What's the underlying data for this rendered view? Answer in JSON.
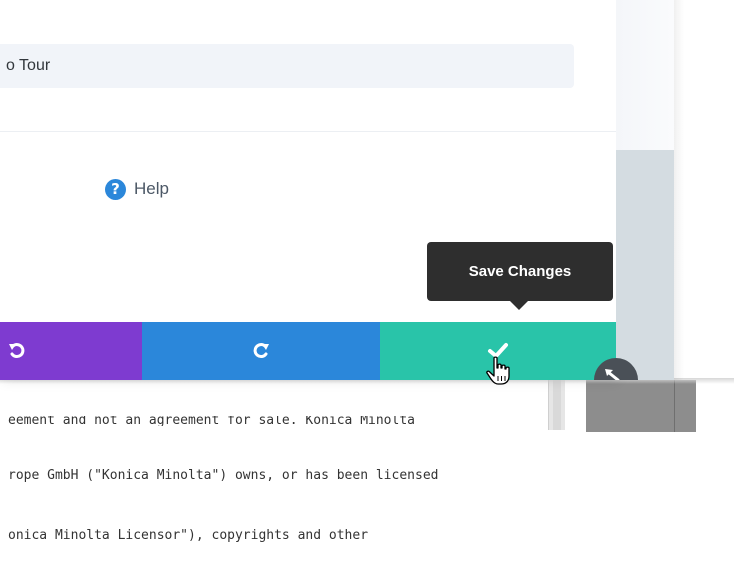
{
  "modal": {
    "tour_field": {
      "value": "o Tour"
    },
    "help": {
      "label": "Help",
      "icon": "help-circle-icon"
    }
  },
  "action_bar": {
    "undo_icon": "undo-icon",
    "redo_icon": "redo-icon",
    "save_icon": "check-icon",
    "colors": {
      "undo": "#7e3bd0",
      "redo": "#2b87da",
      "save": "#29c4a9"
    }
  },
  "tooltip": {
    "text": "Save Changes"
  },
  "background_document": {
    "lines": [
      "eement and not an agreement for sale. Konica Minolta",
      "rope GmbH (\"Konica Minolta\") owns, or has been licensed",
      "onica Minolta Licensor\"), copyrights and other"
    ]
  }
}
